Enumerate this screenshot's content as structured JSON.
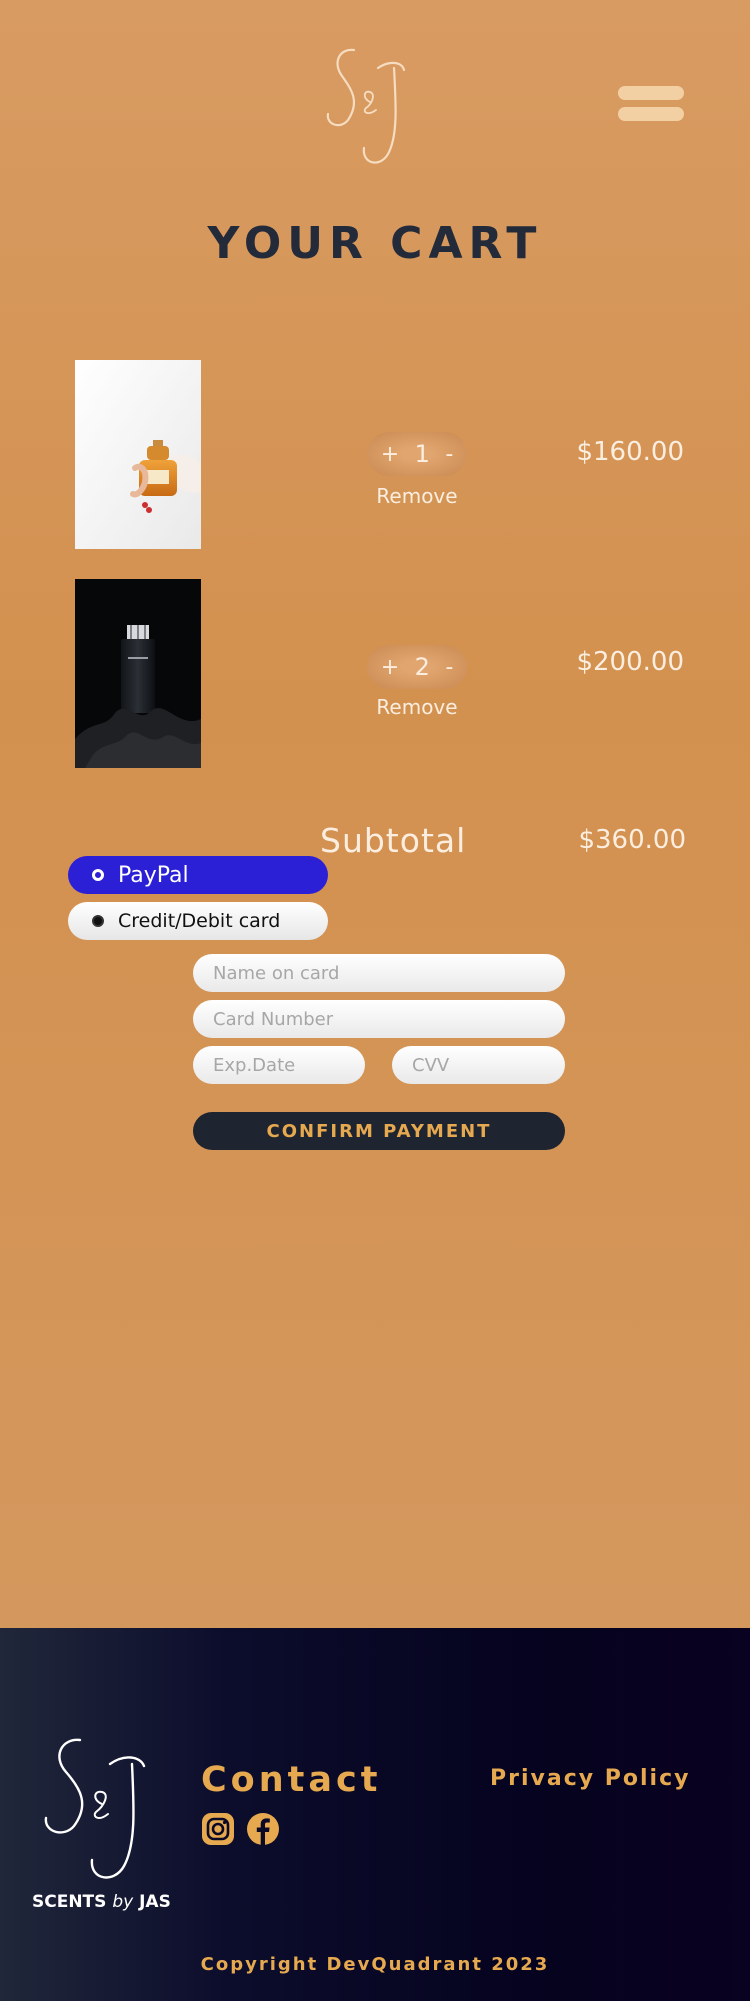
{
  "brand": {
    "logo_monogram": "S&J",
    "name_left": "SCENTS",
    "name_by": "by",
    "name_right": "JAS"
  },
  "icons": {
    "logo": "sj-monogram-logo-icon",
    "menu": "hamburger-menu-icon",
    "instagram": "instagram-icon",
    "facebook": "facebook-icon"
  },
  "colors": {
    "accent": "#e7a94f",
    "title": "#232a3a",
    "paypal": "#2b20d6",
    "button_bg": "#1f2530"
  },
  "cart": {
    "title": "YOUR CART",
    "items": [
      {
        "qty_plus": "+",
        "quantity": "1",
        "qty_minus": "-",
        "remove_label": "Remove",
        "price": "$160.00"
      },
      {
        "qty_plus": "+",
        "quantity": "2",
        "qty_minus": "-",
        "remove_label": "Remove",
        "price": "$200.00"
      }
    ],
    "subtotal_label": "Subtotal",
    "subtotal_value": "$360.00"
  },
  "payment": {
    "paypal_label": "PayPal",
    "card_label": "Credit/Debit card",
    "name_placeholder": "Name on card",
    "number_placeholder": "Card Number",
    "exp_placeholder": "Exp.Date",
    "cvv_placeholder": "CVV",
    "confirm_label": "CONFIRM PAYMENT"
  },
  "footer": {
    "contact_title": "Contact",
    "privacy_label": "Privacy Policy",
    "copyright": "Copyright DevQuadrant 2023"
  }
}
